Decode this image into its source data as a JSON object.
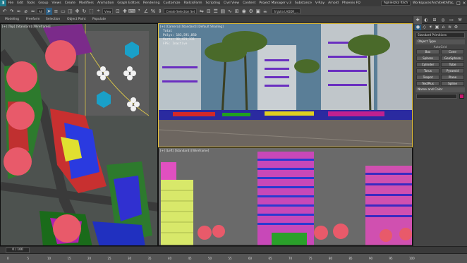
{
  "menu": {
    "items": [
      "File",
      "Edit",
      "Tools",
      "Group",
      "Views",
      "Create",
      "Modifiers",
      "Animation",
      "Graph Editors",
      "Rendering",
      "Customize",
      "RailcisFarm",
      "Scripting",
      "Civil View",
      "Content",
      "Project Manager v.3",
      "Substance",
      "V-Ray",
      "Arnold",
      "Phoenix FD"
    ],
    "user": "Agnieszka Klich",
    "workspaces_label": "Workspaces:",
    "workspace_value": "ArchitektAlfar"
  },
  "toolbar": {
    "filter_value": "All",
    "view_value": "View",
    "selection_set_placeholder": "Create Selection Set",
    "file_name": "S:\\Julia LADDR_..."
  },
  "ribbon": {
    "tabs": [
      "Modeling",
      "Freeform",
      "Selection",
      "Object Paint",
      "Populate"
    ]
  },
  "viewports": {
    "top_label": "[+] [Top] [Standard] [Wireframe]",
    "persp_label": "[+] [Camera] [Standard] [Default Shading]",
    "left_label": "[+] [Left] [Standard] [Wireframe]"
  },
  "stats": {
    "total_label": "Total",
    "polys_label": "Polys:",
    "polys_value": "183,591,850",
    "verts_label": "Verts:",
    "verts_value": "98,421,331",
    "fps_label": "FPS:",
    "fps_value": "Inactive"
  },
  "command_panel": {
    "category_value": "Standard Primitives",
    "object_type_title": "Object Type",
    "autogrid_label": "AutoGrid",
    "objects": [
      "Box",
      "Cone",
      "Sphere",
      "GeoSphere",
      "Cylinder",
      "Tube",
      "Torus",
      "Pyramid",
      "Teapot",
      "Plane",
      "TextPlus",
      "Spline"
    ],
    "name_color_title": "Name and Color",
    "swatch_color": "#c8186e"
  },
  "timeline": {
    "frame_counter": "0 / 100",
    "ticks": [
      "0",
      "5",
      "10",
      "15",
      "20",
      "25",
      "30",
      "35",
      "40",
      "45",
      "50",
      "55",
      "60",
      "65",
      "70",
      "75",
      "80",
      "85",
      "90",
      "95",
      "100"
    ]
  },
  "colors": {
    "accent": "#2c5d82",
    "active_viewport": "#e6c23a",
    "tree_pink": "#e85a6a"
  }
}
